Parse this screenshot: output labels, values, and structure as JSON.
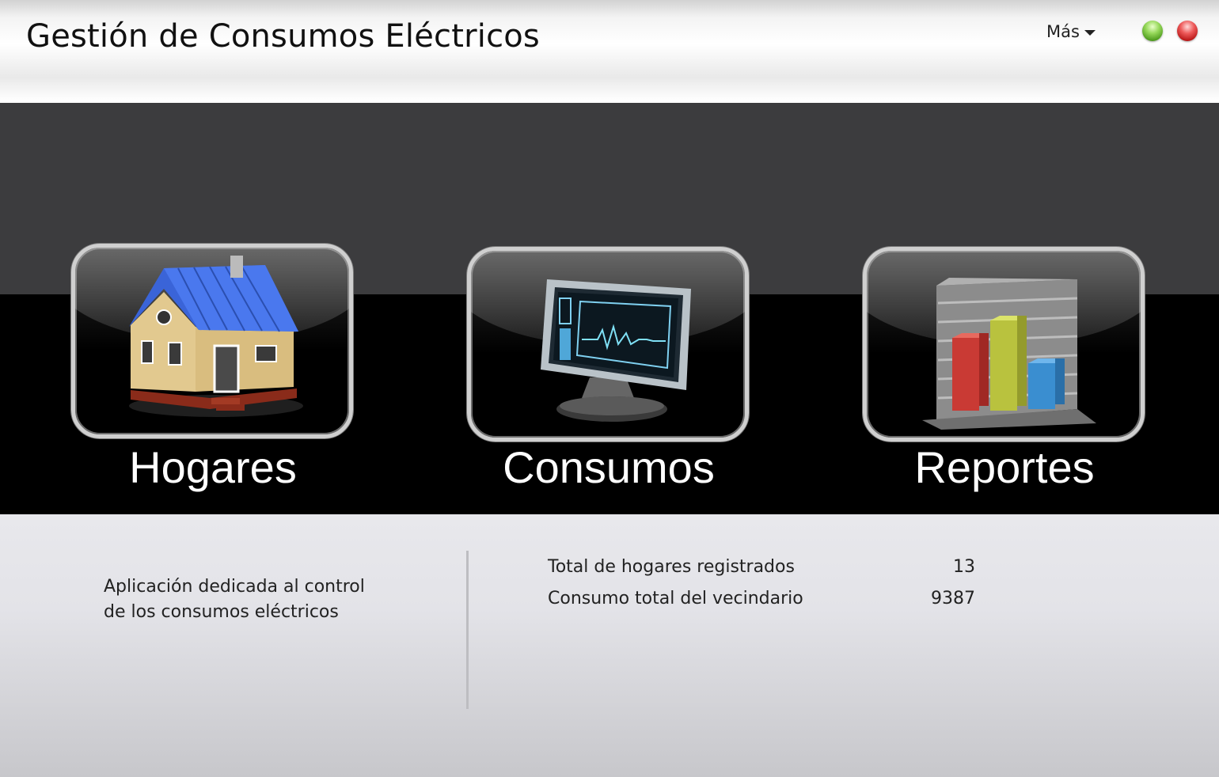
{
  "window": {
    "title": "Gestión de Consumos Eléctricos",
    "more_menu_label": "Más",
    "controls": [
      {
        "name": "maximize",
        "color": "#7cc342"
      },
      {
        "name": "close",
        "color": "#e03a3a"
      }
    ]
  },
  "tiles": [
    {
      "label": "Hogares",
      "icon": "house-icon"
    },
    {
      "label": "Consumos",
      "icon": "monitor-icon"
    },
    {
      "label": "Reportes",
      "icon": "bar-chart-icon"
    }
  ],
  "info": {
    "description_line1": "Aplicación dedicada al control",
    "description_line2": "de los consumos eléctricos",
    "stats": [
      {
        "label": "Total de hogares registrados",
        "value": "13"
      },
      {
        "label": "Consumo total del vecindario",
        "value": "9387"
      }
    ]
  }
}
